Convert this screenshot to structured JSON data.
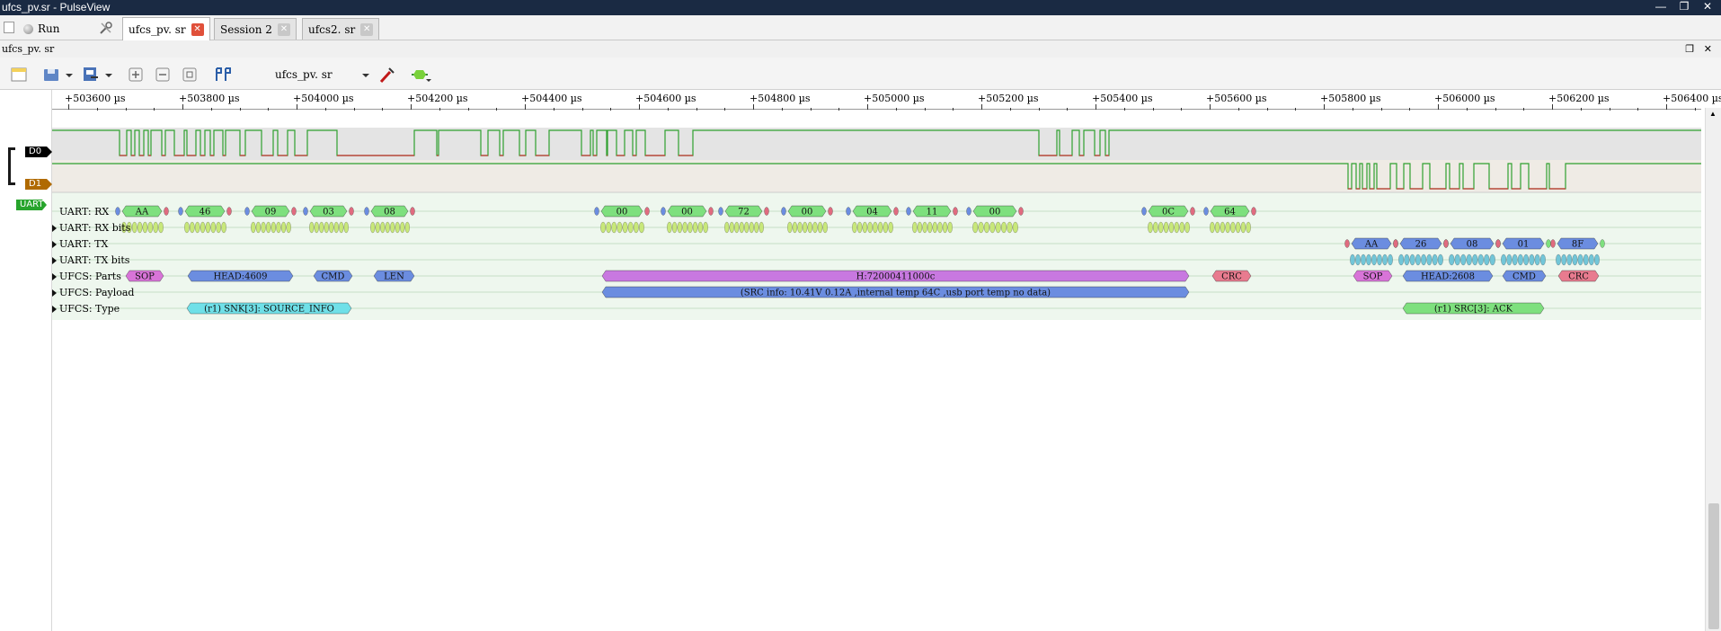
{
  "window": {
    "title": "ufcs_pv.sr - PulseView"
  },
  "tabs": {
    "run_label": "Run",
    "items": [
      {
        "label": "ufcs_pv. sr",
        "active": true
      },
      {
        "label": "Session 2",
        "active": false
      },
      {
        "label": "ufcs2. sr",
        "active": false
      }
    ]
  },
  "session": {
    "title": "ufcs_pv. sr"
  },
  "toolbar": {
    "device": "ufcs_pv. sr"
  },
  "ruler": {
    "unit": "µs",
    "labels": [
      "+503600",
      "+503800",
      "+504000",
      "+504200",
      "+504400",
      "+504600",
      "+504800",
      "+505000",
      "+505200",
      "+505400",
      "+505600",
      "+505800",
      "+506000",
      "+506200",
      "+506400"
    ]
  },
  "channels": [
    {
      "name": "D0",
      "color": "#000000"
    },
    {
      "name": "D1",
      "color": "#b06a00"
    }
  ],
  "decoder": {
    "tag": "UART",
    "rows": [
      "UART: RX",
      "UART: RX bits",
      "UART: TX",
      "UART: TX bits",
      "UFCS: Parts",
      "UFCS: Payload",
      "UFCS: Type"
    ],
    "rx_bytes": [
      "AA",
      "46",
      "09",
      "03",
      "08",
      "00",
      "00",
      "72",
      "00",
      "04",
      "11",
      "00",
      "0C",
      "64"
    ],
    "tx_bytes": [
      "AA",
      "26",
      "08",
      "01",
      "8F"
    ],
    "parts_rx": [
      "SOP",
      "HEAD:4609",
      "CMD",
      "LEN",
      "H:72000411000c",
      "CRC"
    ],
    "parts_tx": [
      "SOP",
      "HEAD:2608",
      "CMD",
      "CRC"
    ],
    "payload": "(SRC info: 10.41V 0.12A ,internal temp 64C ,usb port temp no data)",
    "type_rx": "(r1) SNK[3]: SOURCE_INFO",
    "type_tx": "(r1) SRC[3]: ACK"
  },
  "colors": {
    "uart_byte": "#7ee07e",
    "start_bit": "#6b8de0",
    "stop_bit": "#e06b7f",
    "bits_rx": "#c8e87a",
    "bits_tx": "#72c6d8",
    "part_sop": "#d874d8",
    "part_head": "#6b8de0",
    "part_crc": "#e87b8f",
    "part_h": "#c878e0",
    "type_rx": "#6fe0e8",
    "type_tx": "#7ee07e",
    "trace_high": "#2fa02f",
    "trace_low": "#c83232",
    "decoder_bg": "#eef7ee"
  }
}
